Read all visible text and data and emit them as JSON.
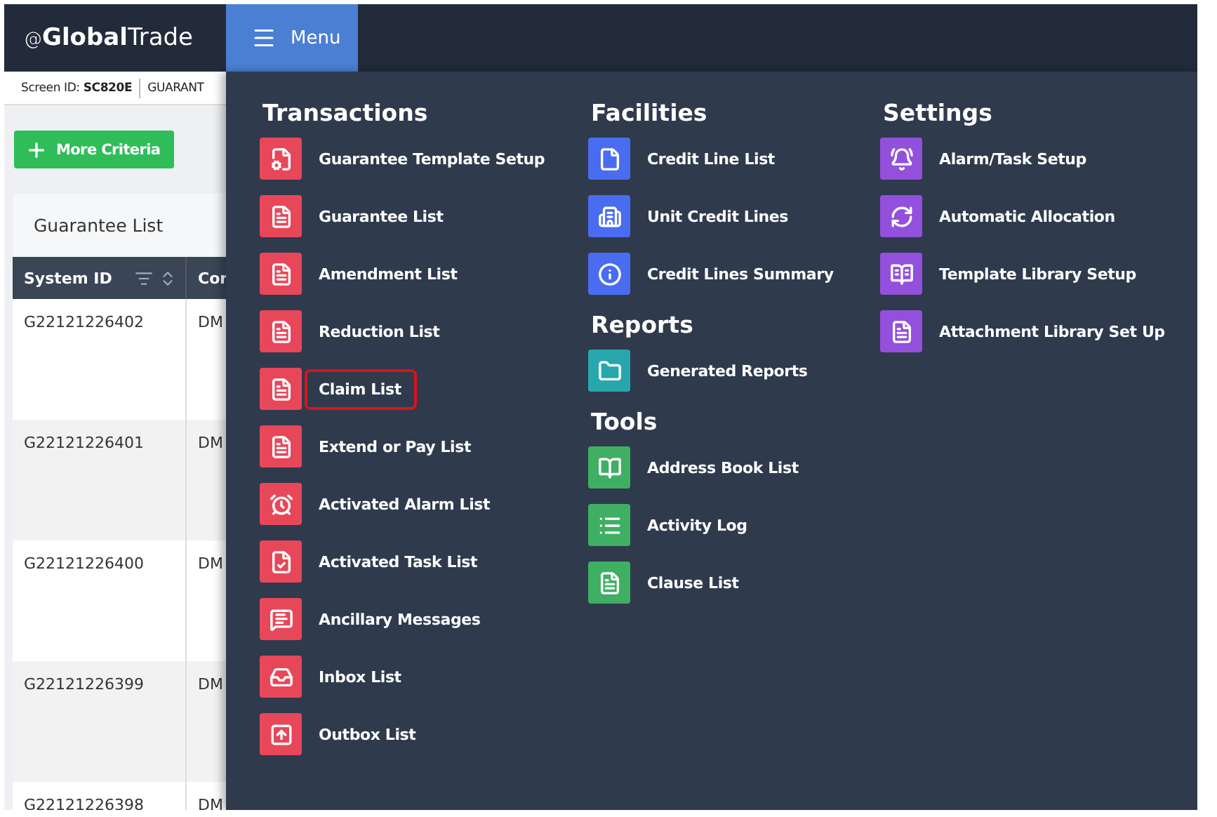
{
  "header": {
    "logo_at": "@",
    "logo_bold": "Global",
    "logo_light": "Trade",
    "menu_button": "Menu"
  },
  "subheader": {
    "label": "Screen ID:",
    "screen_id": "SC820E",
    "title": "GUARANT"
  },
  "more_criteria_button": "More Criteria",
  "table": {
    "title": "Guarantee List",
    "columns": [
      "System ID",
      "Cor"
    ],
    "rows": [
      [
        "G22121226402",
        "DM"
      ],
      [
        "G22121226401",
        "DM"
      ],
      [
        "G22121226400",
        "DM"
      ],
      [
        "G22121226399",
        "DM"
      ],
      [
        "G22121226398",
        "DM"
      ]
    ]
  },
  "menu": {
    "columns": [
      {
        "sections": [
          {
            "title": "Transactions",
            "color": "#e8475a",
            "items": [
              {
                "label": "Guarantee Template Setup",
                "kind": "doc-gear",
                "highlighted": false
              },
              {
                "label": "Guarantee List",
                "kind": "doc",
                "highlighted": false
              },
              {
                "label": "Amendment List",
                "kind": "doc",
                "highlighted": false
              },
              {
                "label": "Reduction List",
                "kind": "doc",
                "highlighted": false
              },
              {
                "label": "Claim List",
                "kind": "doc",
                "highlighted": true
              },
              {
                "label": "Extend or Pay List",
                "kind": "doc",
                "highlighted": false
              },
              {
                "label": "Activated Alarm List",
                "kind": "alarm",
                "highlighted": false
              },
              {
                "label": "Activated Task List",
                "kind": "task",
                "highlighted": false
              },
              {
                "label": "Ancillary Messages",
                "kind": "message",
                "highlighted": false
              },
              {
                "label": "Inbox List",
                "kind": "inbox",
                "highlighted": false
              },
              {
                "label": "Outbox List",
                "kind": "outbox",
                "highlighted": false
              }
            ]
          }
        ]
      },
      {
        "sections": [
          {
            "title": "Facilities",
            "color": "#4a6cf0",
            "items": [
              {
                "label": "Credit Line List",
                "kind": "file"
              },
              {
                "label": "Unit Credit Lines",
                "kind": "building"
              },
              {
                "label": "Credit Lines Summary",
                "kind": "info"
              }
            ]
          },
          {
            "title": "Reports",
            "color": "#27a7ad",
            "items": [
              {
                "label": "Generated Reports",
                "kind": "folder"
              }
            ]
          },
          {
            "title": "Tools",
            "color": "#3faf63",
            "items": [
              {
                "label": "Address Book List",
                "kind": "book"
              },
              {
                "label": "Activity Log",
                "kind": "list"
              },
              {
                "label": "Clause List",
                "kind": "doc"
              }
            ]
          }
        ]
      },
      {
        "sections": [
          {
            "title": "Settings",
            "color": "#9350dc",
            "items": [
              {
                "label": "Alarm/Task Setup",
                "kind": "bell-pen"
              },
              {
                "label": "Automatic Allocation",
                "kind": "refresh"
              },
              {
                "label": "Template Library Setup",
                "kind": "reader"
              },
              {
                "label": "Attachment Library Set Up",
                "kind": "doc"
              }
            ]
          }
        ]
      }
    ]
  }
}
